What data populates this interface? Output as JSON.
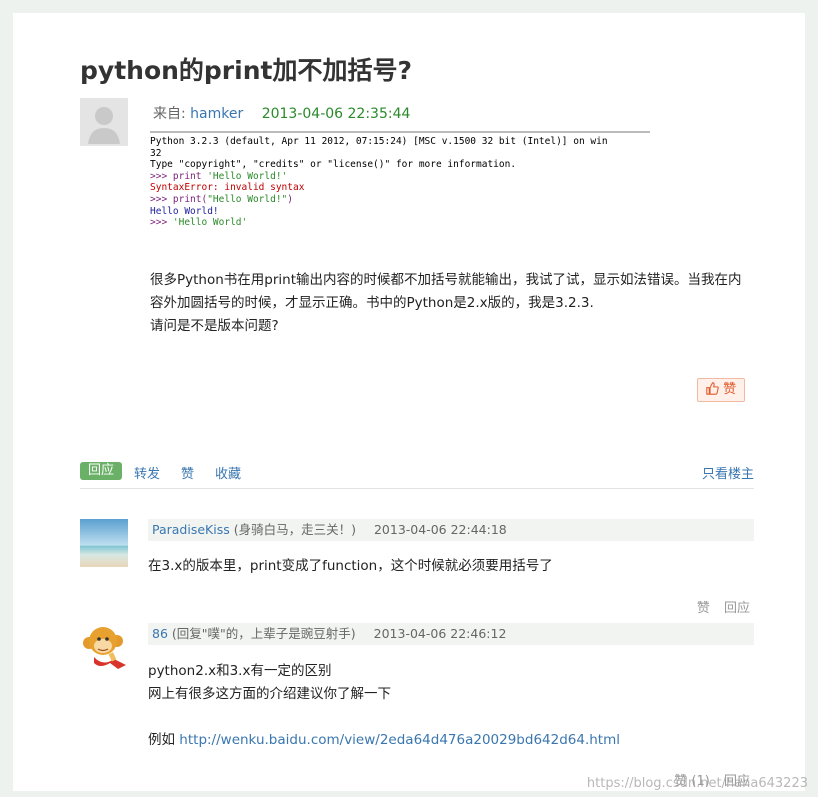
{
  "question": {
    "title": "python的print加不加括号?",
    "from_label": "来自:",
    "author": "hamker",
    "date": "2013-04-06 22:35:44",
    "console": [
      {
        "text": "Python 3.2.3 (default, Apr 11 2012, 07:15:24) [MSC v.1500 32 bit (Intel)] on win",
        "style": "plain"
      },
      {
        "text": "32",
        "style": "plain"
      },
      {
        "text": "Type \"copyright\", \"credits\" or \"license()\" for more information.",
        "style": "plain"
      },
      {
        "prompt": ">>> print ",
        "text": "'Hello World!'",
        "style": "str"
      },
      {
        "text": "SyntaxError: invalid syntax",
        "style": "err"
      },
      {
        "prompt": ">>> print(",
        "text": "\"Hello World!\"",
        "suffix": ")",
        "style": "str"
      },
      {
        "text": "Hello World!",
        "style": "out"
      },
      {
        "prompt": ">>> ",
        "text": "'Hello World'",
        "style": "str"
      }
    ],
    "body_lines": [
      "很多Python书在用print输出内容的时候都不加括号就能输出，我试了试，显示如法错误。当我在内",
      "容外加圆括号的时候，才显示正确。书中的Python是2.x版的，我是3.2.3.",
      "请问是不是版本问题?"
    ],
    "like_label": "赞"
  },
  "actions": {
    "reply": "回应",
    "forward": "转发",
    "like": "赞",
    "favorite": "收藏",
    "only_op": "只看楼主"
  },
  "replies": [
    {
      "user": "ParadiseKiss",
      "note": "(身骑白马，走三关！)",
      "date": "2013-04-06 22:44:18",
      "lines": [
        "在3.x的版本里，print变成了function，这个时候就必须要用括号了"
      ],
      "like": "赞",
      "reply": "回应"
    },
    {
      "user": "86",
      "note": "(回复\"噗\"的，上辈子是豌豆射手)",
      "date": "2013-04-06 22:46:12",
      "lines": [
        "python2.x和3.x有一定的区别",
        "网上有很多这方面的介绍建议你了解一下"
      ],
      "link_prefix": "例如",
      "link": "http://wenku.baidu.com/view/2eda64d476a20029bd642d64.html",
      "like": "赞 (1)",
      "reply": "回应"
    }
  ],
  "watermark": "https://blog.csdn.net/haha643223",
  "colors": {
    "accent_green": "#6ab066",
    "link_blue": "#3a77b0",
    "like_orange": "#e25a2b"
  }
}
